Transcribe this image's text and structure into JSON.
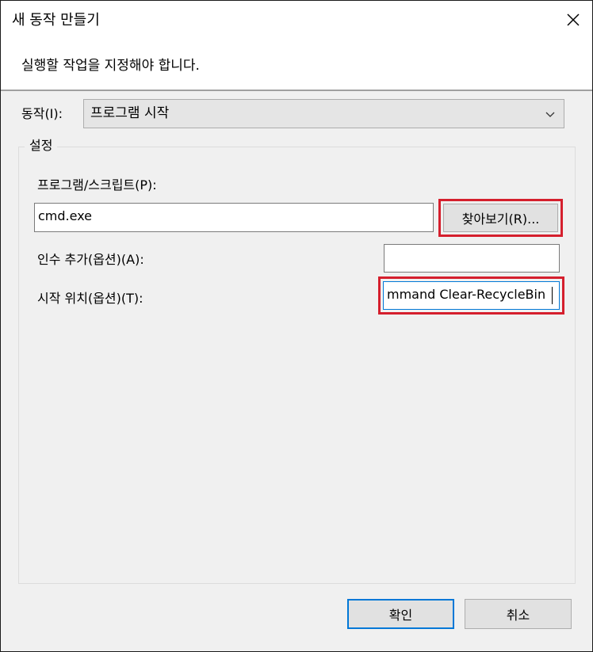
{
  "dialog": {
    "title": "새 동작 만들기",
    "instruction": "실행할 작업을 지정해야 합니다."
  },
  "action": {
    "label": "동작(I):",
    "selected": "프로그램 시작"
  },
  "settings": {
    "legend": "설정",
    "program_label": "프로그램/스크립트(P):",
    "program_value": "cmd.exe",
    "browse_label": "찾아보기(R)...",
    "args_label": "인수 추가(옵션)(A):",
    "args_value": "",
    "start_label": "시작 위치(옵션)(T):",
    "start_value": "mmand Clear-RecycleBin"
  },
  "footer": {
    "ok_label": "확인",
    "cancel_label": "취소"
  },
  "colors": {
    "highlight": "#d51f2d",
    "accent": "#0078d7"
  },
  "icons": {
    "close": "close-icon",
    "dropdown": "chevron-down-icon"
  }
}
